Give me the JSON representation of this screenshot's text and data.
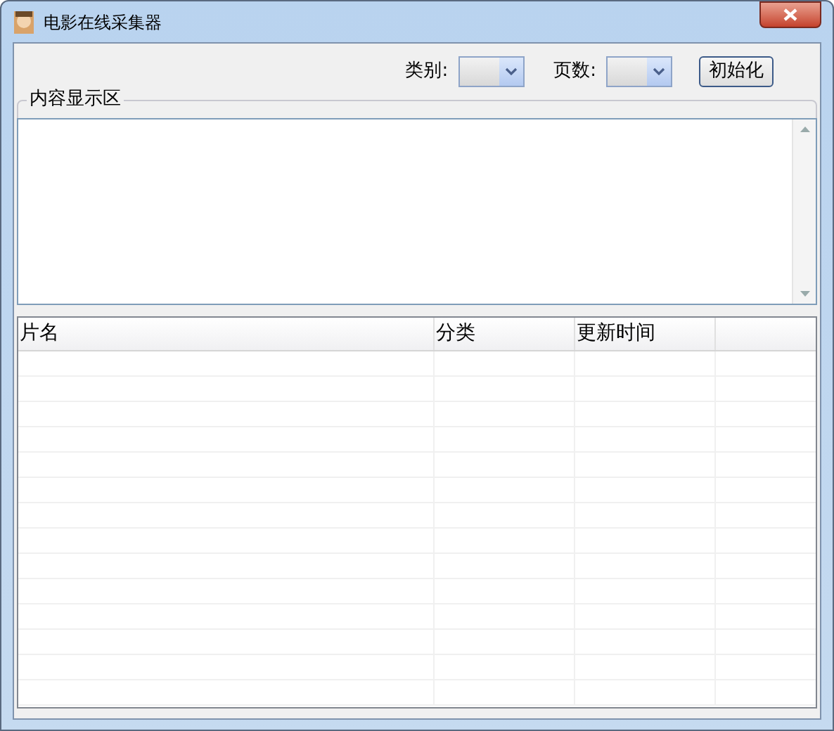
{
  "window": {
    "title": "电影在线采集器"
  },
  "toolbar": {
    "category_label": "类别:",
    "pages_label": "页数:",
    "init_button": "初始化"
  },
  "content_group": {
    "title": "内容显示区"
  },
  "table": {
    "columns": [
      "片名",
      "分类",
      "更新时间"
    ]
  }
}
